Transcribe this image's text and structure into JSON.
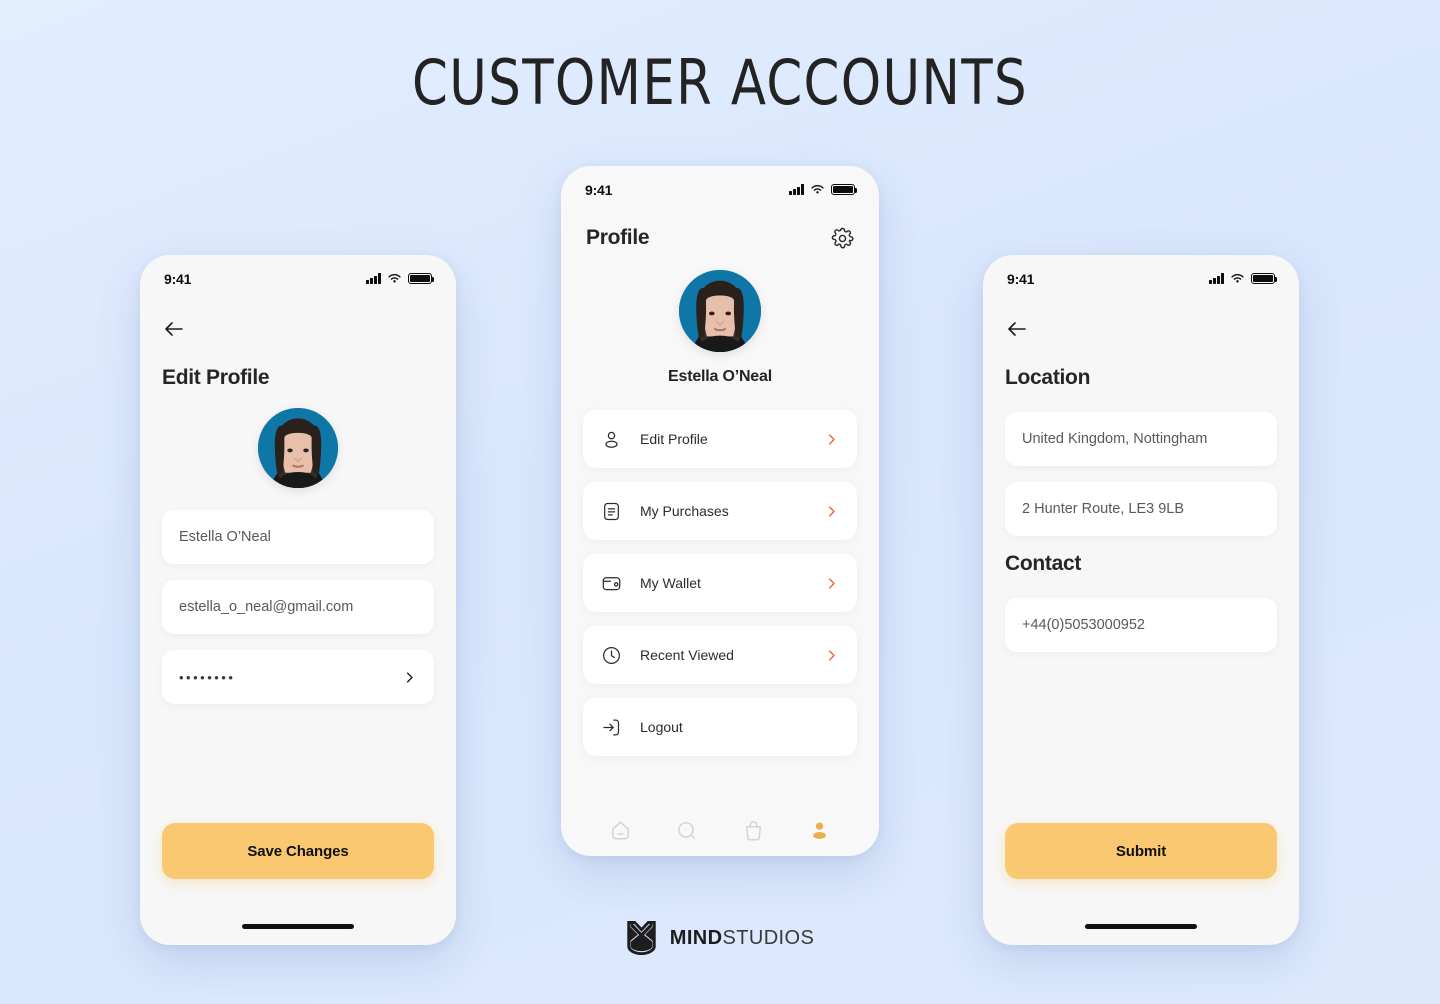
{
  "page": {
    "title": "CUSTOMER ACCOUNTS",
    "background_color": "#dce9fd",
    "accent_color": "#f9c870",
    "chevron_color": "#ef6a3c",
    "avatar_background": "#0f76a8"
  },
  "status_bar": {
    "time": "9:41",
    "icons": [
      "signal-icon",
      "wifi-icon",
      "battery-icon"
    ]
  },
  "edit_profile_screen": {
    "back_icon": "arrow-left-icon",
    "title": "Edit Profile",
    "avatar_alt": "user-avatar",
    "fields": [
      {
        "name": "full-name",
        "value": "Estella O’Neal",
        "icon": null
      },
      {
        "name": "email",
        "value": "estella_o_neal@gmail.com",
        "icon": null
      },
      {
        "name": "password",
        "value": "••••••••",
        "icon": "chevron-right-icon"
      }
    ],
    "submit_label": "Save Changes"
  },
  "profile_screen": {
    "title": "Profile",
    "settings_icon": "gear-icon",
    "user_name": "Estella O’Neal",
    "menu": [
      {
        "label": "Edit Profile",
        "icon": "user-icon",
        "chevron": true
      },
      {
        "label": "My Purchases",
        "icon": "receipt-icon",
        "chevron": true
      },
      {
        "label": "My Wallet",
        "icon": "wallet-icon",
        "chevron": true
      },
      {
        "label": "Recent Viewed",
        "icon": "clock-icon",
        "chevron": true
      },
      {
        "label": "Logout",
        "icon": "logout-icon",
        "chevron": false
      }
    ],
    "tabs": [
      {
        "name": "home",
        "icon": "home-icon",
        "active": false
      },
      {
        "name": "search",
        "icon": "search-icon",
        "active": false
      },
      {
        "name": "bag",
        "icon": "bag-icon",
        "active": false
      },
      {
        "name": "profile",
        "icon": "person-icon",
        "active": true
      }
    ]
  },
  "location_screen": {
    "back_icon": "arrow-left-icon",
    "section_location_title": "Location",
    "location_fields": [
      {
        "name": "country-city",
        "value": "United Kingdom, Nottingham"
      },
      {
        "name": "street-address",
        "value": "2 Hunter Route, LE3 9LB"
      }
    ],
    "section_contact_title": "Contact",
    "contact_fields": [
      {
        "name": "phone-number",
        "value": "+44(0)5053000952"
      }
    ],
    "submit_label": "Submit"
  },
  "footer": {
    "logo_icon": "mindstudios-shield-icon",
    "brand_bold": "MIND",
    "brand_light": "STUDIOS"
  }
}
